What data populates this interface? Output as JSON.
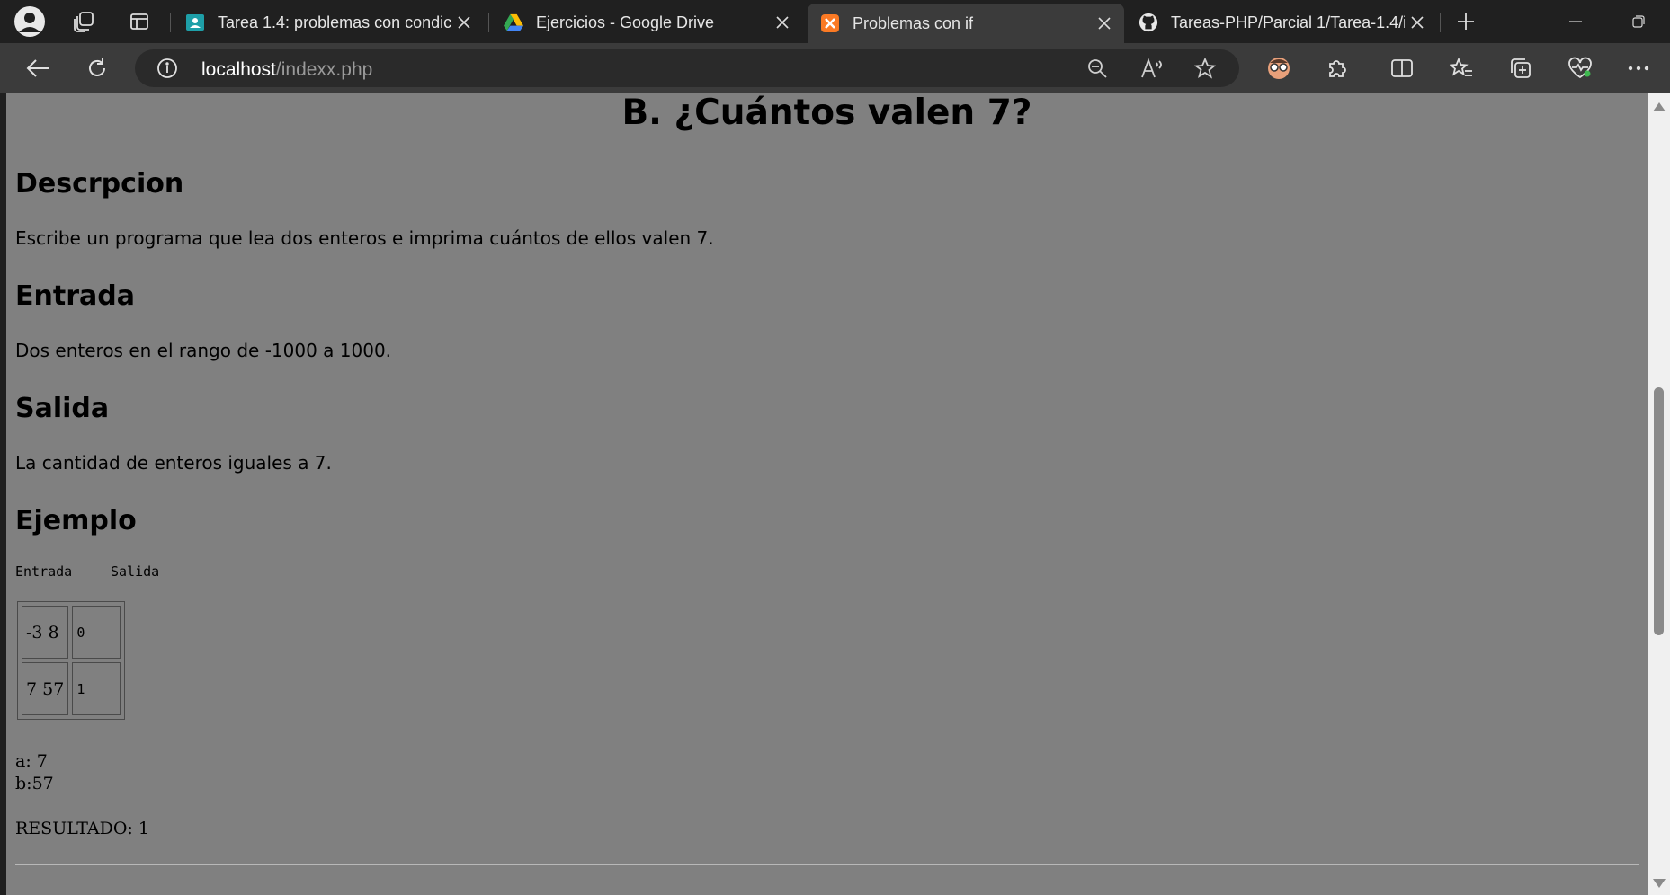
{
  "tabs": [
    {
      "label": "Tarea 1.4: problemas con condic",
      "icon": "classroom-icon",
      "active": false
    },
    {
      "label": "Ejercicios - Google Drive",
      "icon": "google-drive-icon",
      "active": false
    },
    {
      "label": "Problemas con if",
      "icon": "xampp-icon",
      "active": true
    },
    {
      "label": "Tareas-PHP/Parcial 1/Tarea-1.4/i",
      "icon": "github-icon",
      "active": false
    }
  ],
  "address_bar": {
    "host": "localhost",
    "path": "/indexx.php"
  },
  "page": {
    "title": "B. ¿Cuántos valen 7?",
    "description_heading": "Descrpcion",
    "description_text": "Escribe un programa que lea dos enteros e imprima cuántos de ellos valen 7.",
    "input_heading": "Entrada",
    "input_text": "Dos enteros en el rango de -1000 a 1000.",
    "output_heading": "Salida",
    "output_text": "La cantidad de enteros iguales a 7.",
    "example_heading": "Ejemplo",
    "example_col_input": "Entrada",
    "example_col_output": "Salida",
    "example_rows": [
      {
        "input": "-3 8",
        "output": "0"
      },
      {
        "input": "7 57",
        "output": "1"
      }
    ],
    "var_a": "a: 7",
    "var_b": "b:57",
    "result": "RESULTADO: 1"
  },
  "colors": {
    "page_background": "#808080",
    "chrome_dark": "#202020",
    "chrome_toolbar": "#3b3b3b"
  }
}
